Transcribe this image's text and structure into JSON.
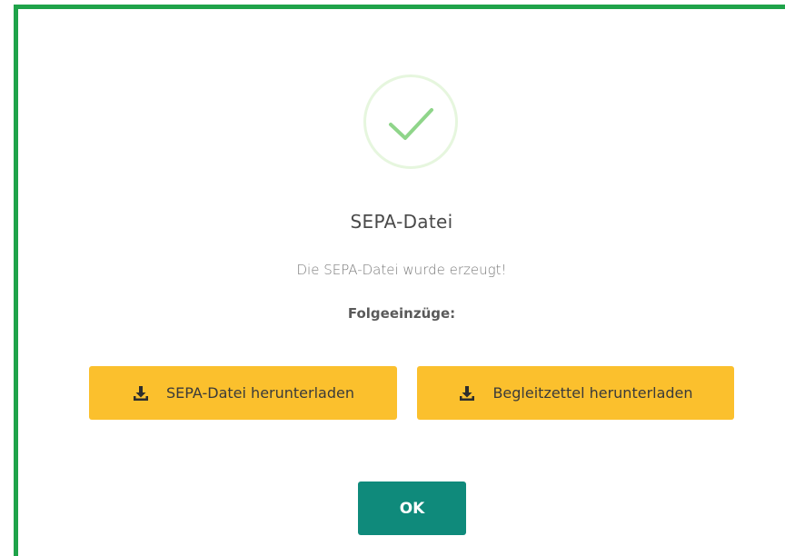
{
  "dialog": {
    "icon": "checkmark-circle-icon",
    "title": "SEPA-Datei",
    "message": "Die SEPA-Datei wurde erzeugt!",
    "subheading": "Folgeeinzüge:",
    "buttons": {
      "download_sepa": {
        "label": "SEPA-Datei herunterladen",
        "icon": "download-icon"
      },
      "download_slip": {
        "label": "Begleitzettel herunterladen",
        "icon": "download-icon"
      },
      "ok": {
        "label": "OK"
      }
    }
  },
  "colors": {
    "frame_border": "#1fa34a",
    "check": "#8fd58a",
    "download_button": "#fbc02d",
    "ok_button": "#0f8a7b"
  }
}
